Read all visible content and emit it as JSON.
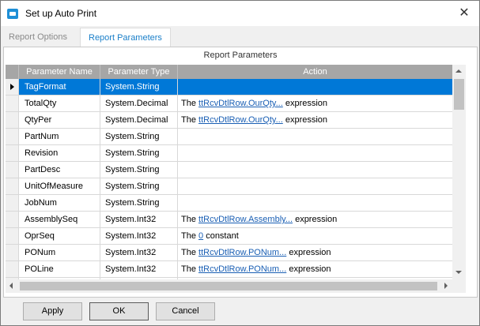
{
  "window": {
    "title": "Set up Auto Print",
    "close_label": "✕"
  },
  "tabs": [
    {
      "label": "Report Options"
    },
    {
      "label": "Report Parameters"
    }
  ],
  "panel": {
    "caption": "Report Parameters"
  },
  "grid": {
    "columns": [
      "Parameter Name",
      "Parameter Type",
      "Action"
    ],
    "rows": [
      {
        "name": "TagFormat",
        "type": "System.String",
        "action_prefix": "",
        "action_link": "",
        "action_suffix": "",
        "selected": true
      },
      {
        "name": "TotalQty",
        "type": "System.Decimal",
        "action_prefix": "The ",
        "action_link": "ttRcvDtlRow.OurQty...",
        "action_suffix": " expression"
      },
      {
        "name": "QtyPer",
        "type": "System.Decimal",
        "action_prefix": "The ",
        "action_link": "ttRcvDtlRow.OurQty...",
        "action_suffix": " expression"
      },
      {
        "name": "PartNum",
        "type": "System.String",
        "action_prefix": "",
        "action_link": "",
        "action_suffix": ""
      },
      {
        "name": "Revision",
        "type": "System.String",
        "action_prefix": "",
        "action_link": "",
        "action_suffix": ""
      },
      {
        "name": "PartDesc",
        "type": "System.String",
        "action_prefix": "",
        "action_link": "",
        "action_suffix": ""
      },
      {
        "name": "UnitOfMeasure",
        "type": "System.String",
        "action_prefix": "",
        "action_link": "",
        "action_suffix": ""
      },
      {
        "name": "JobNum",
        "type": "System.String",
        "action_prefix": "",
        "action_link": "",
        "action_suffix": ""
      },
      {
        "name": "AssemblySeq",
        "type": "System.Int32",
        "action_prefix": "The ",
        "action_link": "ttRcvDtlRow.Assembly...",
        "action_suffix": " expression"
      },
      {
        "name": "OprSeq",
        "type": "System.Int32",
        "action_prefix": "The ",
        "action_link": "0",
        "action_suffix": " constant"
      },
      {
        "name": "PONum",
        "type": "System.Int32",
        "action_prefix": "The ",
        "action_link": "ttRcvDtlRow.PONum...",
        "action_suffix": " expression"
      },
      {
        "name": "POLine",
        "type": "System.Int32",
        "action_prefix": "The ",
        "action_link": "ttRcvDtlRow.PONum...",
        "action_suffix": " expression"
      },
      {
        "name": "",
        "type": "",
        "action_prefix": "",
        "action_link": "",
        "action_suffix": ""
      }
    ]
  },
  "buttons": {
    "apply": "Apply",
    "ok": "OK",
    "cancel": "Cancel"
  },
  "colors": {
    "accent": "#0078d7",
    "link": "#1a5fb4",
    "header": "#a6a6a6",
    "active_tab": "#1a7fc9"
  }
}
